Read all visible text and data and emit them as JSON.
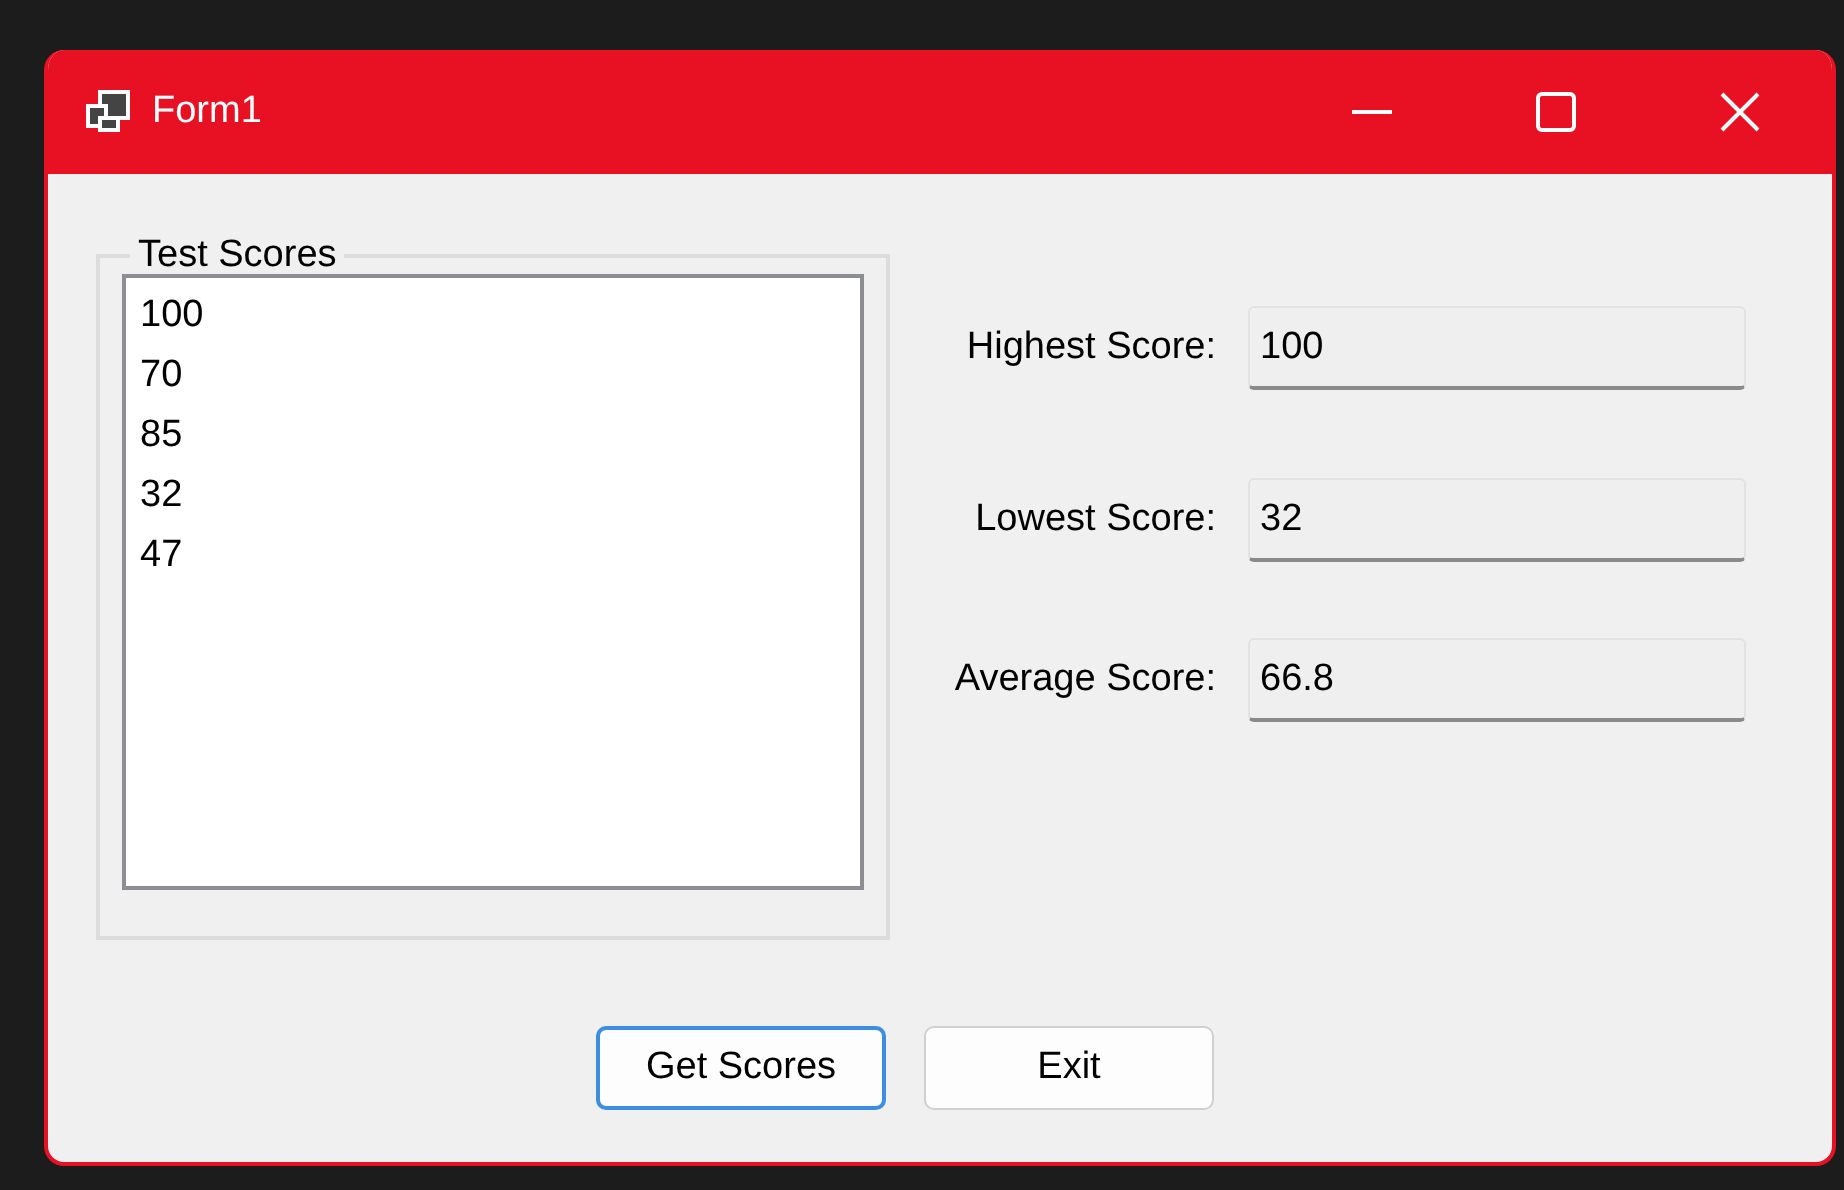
{
  "window": {
    "title": "Form1"
  },
  "group": {
    "title": "Test Scores",
    "items": [
      "100",
      "70",
      "85",
      "32",
      "47"
    ]
  },
  "results": [
    {
      "label": "Highest Score:",
      "value": "100"
    },
    {
      "label": "Lowest Score:",
      "value": "32"
    },
    {
      "label": "Average Score:",
      "value": "66.8"
    }
  ],
  "buttons": [
    {
      "label": "Get Scores",
      "focused": true
    },
    {
      "label": "Exit",
      "focused": false
    }
  ]
}
